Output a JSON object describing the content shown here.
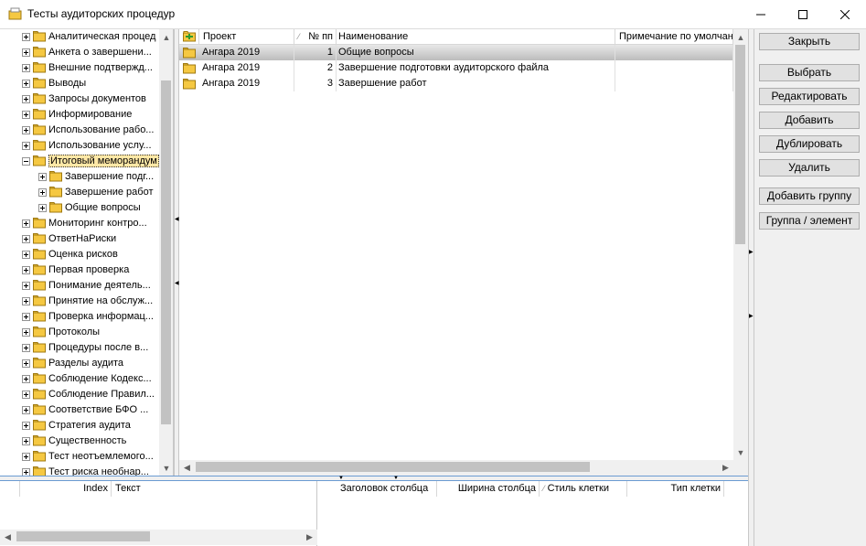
{
  "window": {
    "title": "Тесты аудиторских процедур",
    "minimize_glyph": "—",
    "maximize_glyph": "☐",
    "close_glyph": "✕"
  },
  "tree": {
    "items": [
      {
        "label": "Аналитическая процед",
        "level": 0,
        "expander": "plus"
      },
      {
        "label": "Анкета о завершени...",
        "level": 0,
        "expander": "plus"
      },
      {
        "label": "Внешние подтвержд...",
        "level": 0,
        "expander": "plus"
      },
      {
        "label": "Выводы",
        "level": 0,
        "expander": "plus"
      },
      {
        "label": "Запросы документов",
        "level": 0,
        "expander": "plus"
      },
      {
        "label": "Информирование",
        "level": 0,
        "expander": "plus"
      },
      {
        "label": "Использование рабо...",
        "level": 0,
        "expander": "plus"
      },
      {
        "label": "Использование услу...",
        "level": 0,
        "expander": "plus"
      },
      {
        "label": "Итоговый меморандум",
        "level": 0,
        "expander": "minus",
        "selected": true
      },
      {
        "label": "Завершение подг...",
        "level": 1,
        "expander": "plus"
      },
      {
        "label": "Завершение работ",
        "level": 1,
        "expander": "plus"
      },
      {
        "label": "Общие вопросы",
        "level": 1,
        "expander": "plus"
      },
      {
        "label": "Мониторинг контро...",
        "level": 0,
        "expander": "plus"
      },
      {
        "label": "ОтветНаРиски",
        "level": 0,
        "expander": "plus"
      },
      {
        "label": "Оценка рисков",
        "level": 0,
        "expander": "plus"
      },
      {
        "label": "Первая проверка",
        "level": 0,
        "expander": "plus"
      },
      {
        "label": "Понимание деятель...",
        "level": 0,
        "expander": "plus"
      },
      {
        "label": "Принятие на обслуж...",
        "level": 0,
        "expander": "plus"
      },
      {
        "label": "Проверка информац...",
        "level": 0,
        "expander": "plus"
      },
      {
        "label": "Протоколы",
        "level": 0,
        "expander": "plus"
      },
      {
        "label": "Процедуры после в...",
        "level": 0,
        "expander": "plus"
      },
      {
        "label": "Разделы аудита",
        "level": 0,
        "expander": "plus"
      },
      {
        "label": "Соблюдение Кодекс...",
        "level": 0,
        "expander": "plus"
      },
      {
        "label": "Соблюдение Правил...",
        "level": 0,
        "expander": "plus"
      },
      {
        "label": "Соответствие БФО ...",
        "level": 0,
        "expander": "plus"
      },
      {
        "label": "Стратегия аудита",
        "level": 0,
        "expander": "plus"
      },
      {
        "label": "Существенность",
        "level": 0,
        "expander": "plus"
      },
      {
        "label": "Тест неотъемлемого...",
        "level": 0,
        "expander": "plus"
      },
      {
        "label": "Тест риска необнар...",
        "level": 0,
        "expander": "plus"
      }
    ]
  },
  "grid": {
    "columns": [
      "Проект",
      "№ пп",
      "Наименование",
      "Примечание по умолчанию"
    ],
    "rows": [
      {
        "project": "Ангара 2019",
        "num": "1",
        "name": "Общие вопросы",
        "note": "",
        "selected": true
      },
      {
        "project": "Ангара 2019",
        "num": "2",
        "name": "Завершение подготовки аудиторского файла",
        "note": ""
      },
      {
        "project": "Ангара 2019",
        "num": "3",
        "name": "Завершение работ",
        "note": ""
      }
    ]
  },
  "buttons": {
    "close": "Закрыть",
    "select": "Выбрать",
    "edit": "Редактировать",
    "add": "Добавить",
    "duplicate": "Дублировать",
    "delete": "Удалить",
    "add_group": "Добавить группу",
    "group_element": "Группа / элемент"
  },
  "bottom_left": {
    "columns": [
      "Index",
      "Текст"
    ]
  },
  "bottom_right": {
    "columns": [
      "Заголовок столбца",
      "Ширина столбца",
      "Стиль клетки",
      "Тип клетки"
    ]
  },
  "colors": {
    "folder": "#f5c842",
    "selected_tree_bg": "#ffe8a6",
    "splitter_accent": "#6b9bd2"
  }
}
